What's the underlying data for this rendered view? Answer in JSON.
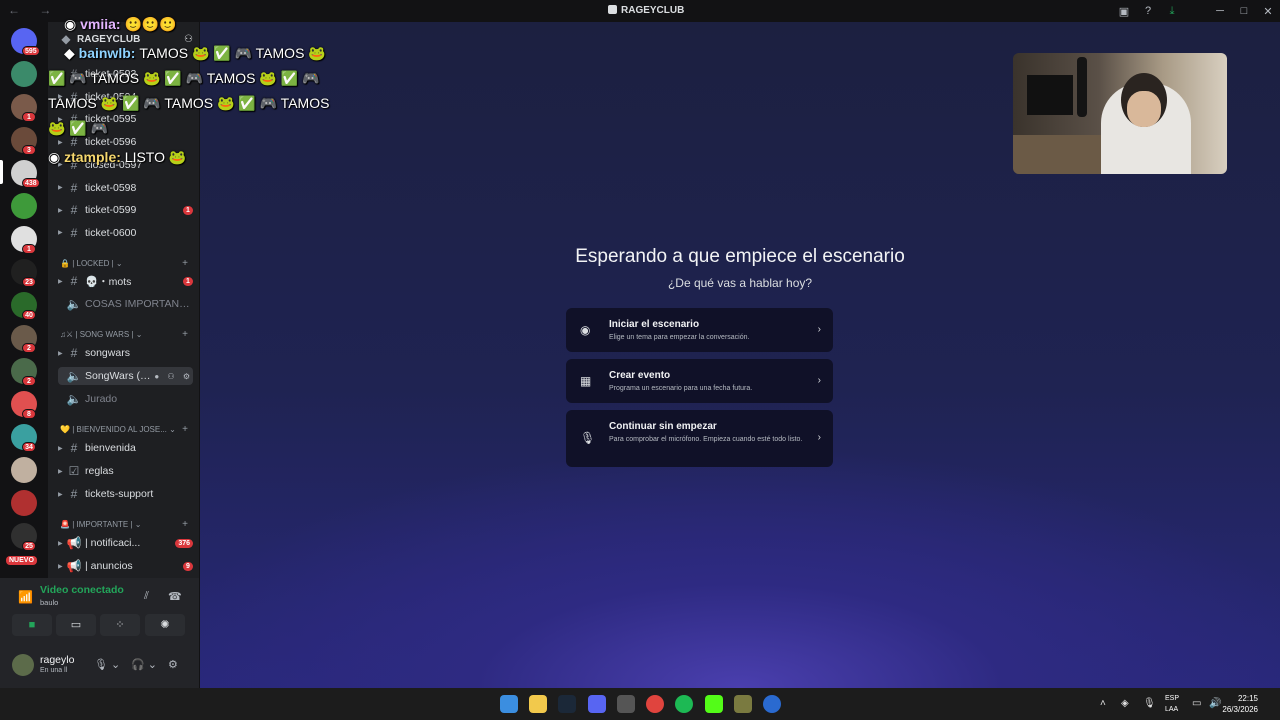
{
  "window": {
    "title": "RAGEYCLUB"
  },
  "servers": [
    {
      "color": "#5865f2",
      "badge": "595"
    },
    {
      "color": "#3b8a6a",
      "badge": ""
    },
    {
      "color": "#7a5a4a",
      "badge": "1"
    },
    {
      "color": "#6a4a3a",
      "badge": "3"
    },
    {
      "color": "#d0d0d0",
      "badge": "438"
    },
    {
      "color": "#3e9a3a",
      "badge": ""
    },
    {
      "color": "#e0e0e0",
      "badge": "1"
    },
    {
      "color": "#202020",
      "badge": "23"
    },
    {
      "color": "#2a6a2a",
      "badge": "40"
    },
    {
      "color": "#6a5a4a",
      "badge": "2"
    },
    {
      "color": "#4a6a4a",
      "badge": "2"
    },
    {
      "color": "#e05050",
      "badge": "8"
    },
    {
      "color": "#3aa0a0",
      "badge": "34"
    },
    {
      "color": "#c0b0a0",
      "badge": ""
    },
    {
      "color": "#b03030",
      "badge": ""
    },
    {
      "color": "#303030",
      "badge": "25"
    }
  ],
  "server_new_label": "NUEVO",
  "sidebar": {
    "server_name": "RAGEYCLUB",
    "channels_top": [
      {
        "name": "ticket-0593"
      },
      {
        "name": "ticket-0594"
      },
      {
        "name": "ticket-0595"
      },
      {
        "name": "ticket-0596"
      },
      {
        "name": "closed-0597"
      },
      {
        "name": "ticket-0598"
      },
      {
        "name": "ticket-0599",
        "badge": "1"
      },
      {
        "name": "ticket-0600"
      }
    ],
    "cat_locked": "| LOCKED |",
    "mots": {
      "name": "💀・mots",
      "badge": "1"
    },
    "cosas": "COSAS IMPORTANTES",
    "cat_song": "| SONG WARS |",
    "songwars": "songwars",
    "songwars_voice": "SongWars (S...",
    "jurado": "Jurado",
    "cat_bienvenido": "| BIENVENIDO AL JOSE...",
    "bienvenida": "bienvenida",
    "reglas": "reglas",
    "tickets_support": "tickets-support",
    "cat_importante": "| IMPORTANTE |",
    "notificaciones": {
      "name": "| notificaci...",
      "badge": "376"
    },
    "anuncios": {
      "name": "| anuncios",
      "badge": "9"
    }
  },
  "voice_panel": {
    "status": "Video conectado",
    "channel": "baulo"
  },
  "user": {
    "name": "rageylo",
    "status": "En una ll"
  },
  "stage": {
    "title": "Esperando a que empiece el escenario",
    "subtitle": "¿De qué vas a hablar hoy?",
    "options": [
      {
        "title": "Iniciar el escenario",
        "desc": "Elige un tema para empezar la conversación."
      },
      {
        "title": "Crear evento",
        "desc": "Programa un escenario para una fecha futura."
      },
      {
        "title": "Continuar sin empezar",
        "desc": "Para comprobar el micrófono. Empieza cuando esté todo listo."
      }
    ]
  },
  "chat_overlay": {
    "line1_user": "vmiia:",
    "line2_user": "bainwlb:",
    "line2_msg": "TAMOS 🐸 ✅ 🎮 TAMOS 🐸",
    "line3_msg": "✅ 🎮 TAMOS 🐸 ✅ 🎮 TAMOS 🐸 ✅ 🎮",
    "line4_msg": "TAMOS 🐸 ✅ 🎮 TAMOS 🐸 ✅ 🎮 TAMOS",
    "line6_user": "ztample:",
    "line6_msg": "LISTO 🐸"
  },
  "taskbar": {
    "lang1": "ESP",
    "lang2": "LAA",
    "time": "22:15",
    "date": "26/3/2026"
  }
}
